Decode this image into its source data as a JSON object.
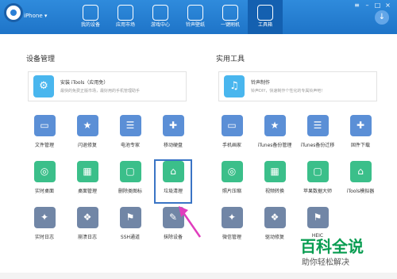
{
  "header": {
    "device": "iPhone ▾",
    "tabs": [
      "我的设备",
      "应用市场",
      "游戏中心",
      "铃声壁纸",
      "一键刷机",
      "工具箱"
    ],
    "active": 5
  },
  "left": {
    "title": "设备管理",
    "card_title": "安装 iTools（应用免）",
    "card_desc": "最快的免费正版市场，最好用的手机管理助手",
    "apps": [
      [
        "文件管理",
        "闪退修复",
        "电池专家",
        "移动硬盘"
      ],
      [
        "实时桌面",
        "桌面管理",
        "删除类图标",
        "垃圾清理"
      ],
      [
        "实时日志",
        "崩溃日志",
        "SSH通道",
        "抹除设备"
      ]
    ]
  },
  "right": {
    "title": "实用工具",
    "card_title": "铃声制作",
    "card_desc": "铃声DIY，快速制作个性化的专属铃声吧！",
    "apps": [
      [
        "手机画家",
        "iTunes备份管理",
        "iTunes备份迁移",
        "固件下载"
      ],
      [
        "照片压缩",
        "视频转换",
        "苹果数据大师",
        "iTools模拟器"
      ],
      [
        "微信管理",
        "驱动修复",
        "HEIC"
      ]
    ]
  },
  "watermark": {
    "title": "百科全说",
    "sub": "助你轻松解决"
  },
  "colors": {
    "bar": "#1e74c8",
    "green": "#3bbf8a",
    "blue": "#5b8fd6",
    "gray": "#7186a6"
  }
}
